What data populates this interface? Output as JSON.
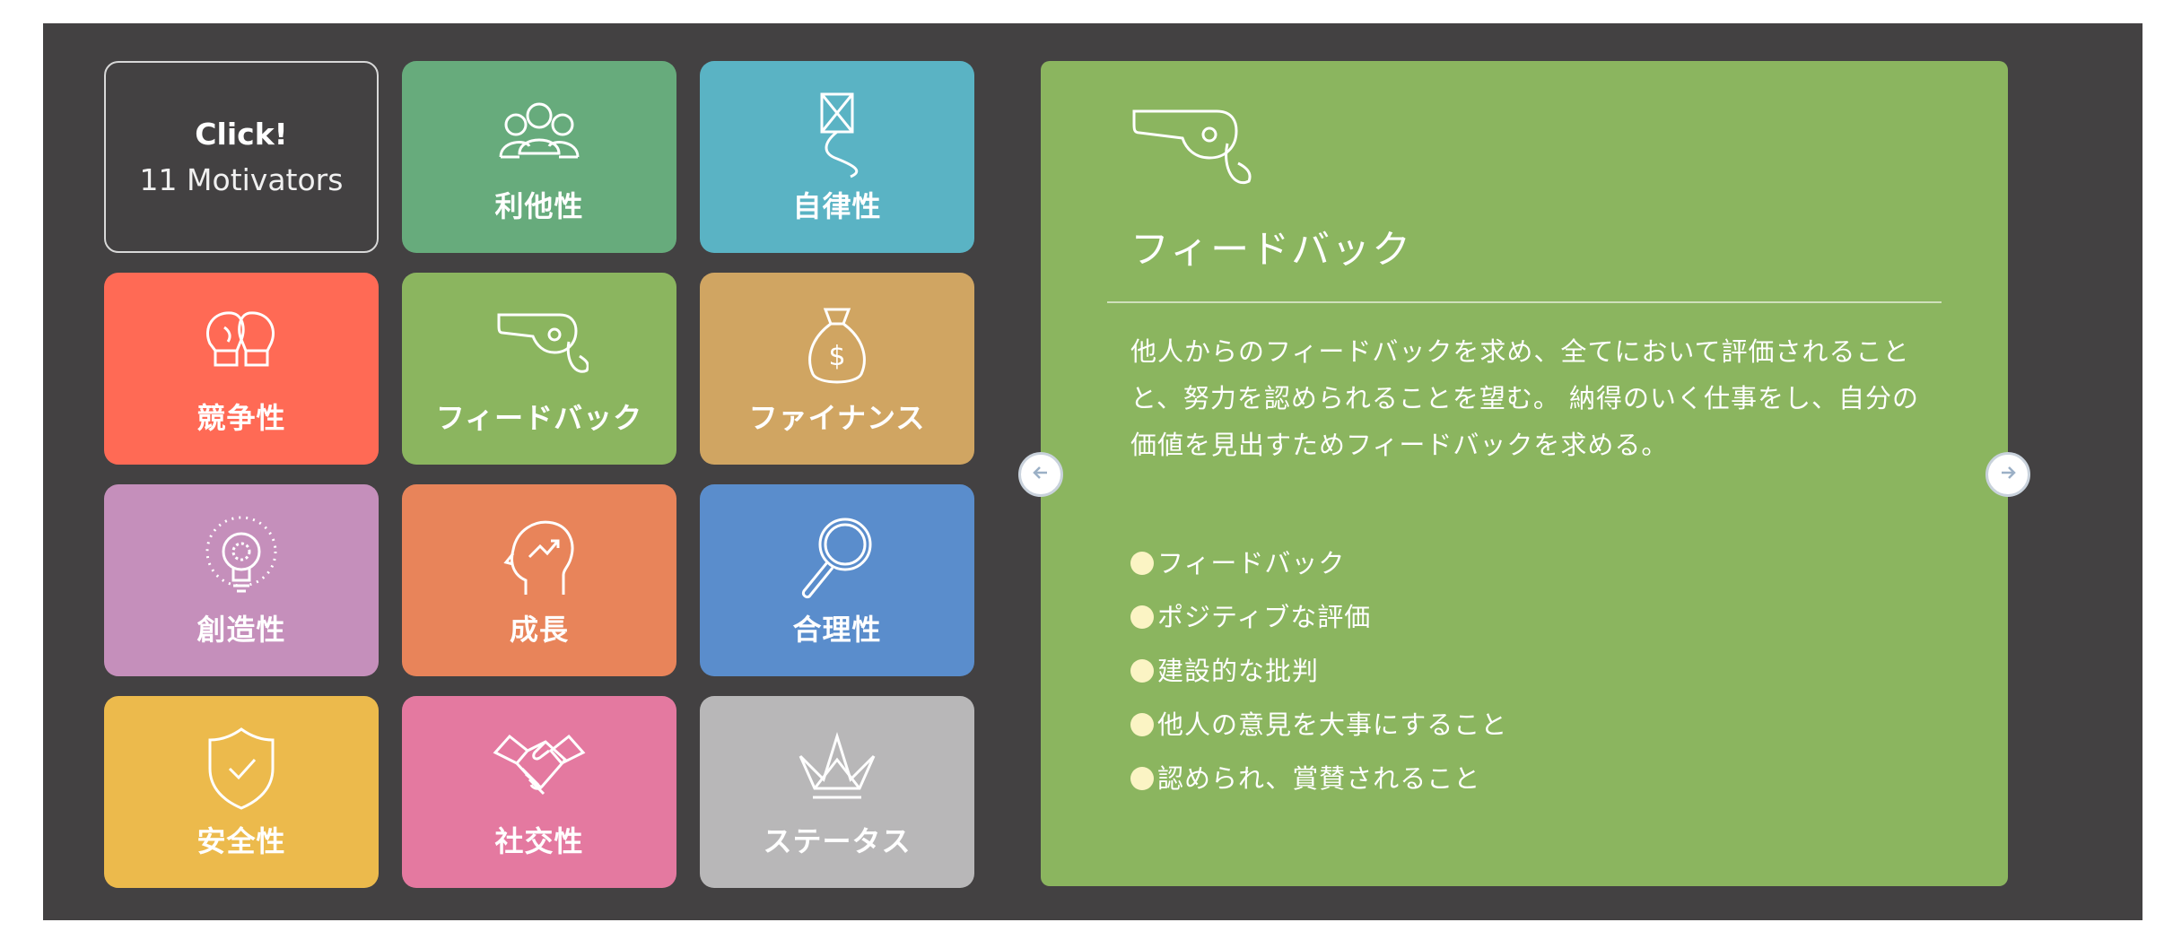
{
  "grid": {
    "click_tile": {
      "title": "Click!",
      "subtitle": "11 Motivators"
    },
    "tiles": [
      {
        "label": "利他性",
        "icon": "people-group-icon",
        "color": "#67ab7c"
      },
      {
        "label": "自律性",
        "icon": "kite-icon",
        "color": "#5ab3c4"
      },
      {
        "label": "競争性",
        "icon": "boxing-gloves-icon",
        "color": "#ff6a55"
      },
      {
        "label": "フィードバック",
        "icon": "whistle-icon",
        "color": "#8bb55f"
      },
      {
        "label": "ファイナンス",
        "icon": "money-bag-icon",
        "color": "#d0a562"
      },
      {
        "label": "創造性",
        "icon": "light-bulb-icon",
        "color": "#c58fbb"
      },
      {
        "label": "成長",
        "icon": "head-growth-icon",
        "color": "#e8845a"
      },
      {
        "label": "合理性",
        "icon": "magnifier-icon",
        "color": "#5a8dcc"
      },
      {
        "label": "安全性",
        "icon": "shield-check-icon",
        "color": "#ecba4c"
      },
      {
        "label": "社交性",
        "icon": "handshake-icon",
        "color": "#e479a0"
      },
      {
        "label": "ステータス",
        "icon": "crown-icon",
        "color": "#b8b7b8"
      }
    ]
  },
  "detail": {
    "icon": "whistle-icon",
    "title": "フィードバック",
    "description_lines": [
      "他人からのフィードバックを求め、全てにおいて評価されること",
      "と、努力を認められることを望む。 納得のいく仕事をし、自分の",
      "価値を見出すためフィードバックを求める。"
    ],
    "points": [
      "フィードバック",
      "ポジティブな評価",
      "建設的な批判",
      "他人の意見を大事にすること",
      "認められ、賞賛されること"
    ],
    "background": "#8bb55f"
  },
  "nav": {
    "prev_icon": "arrow-left-icon",
    "next_icon": "arrow-right-icon"
  }
}
